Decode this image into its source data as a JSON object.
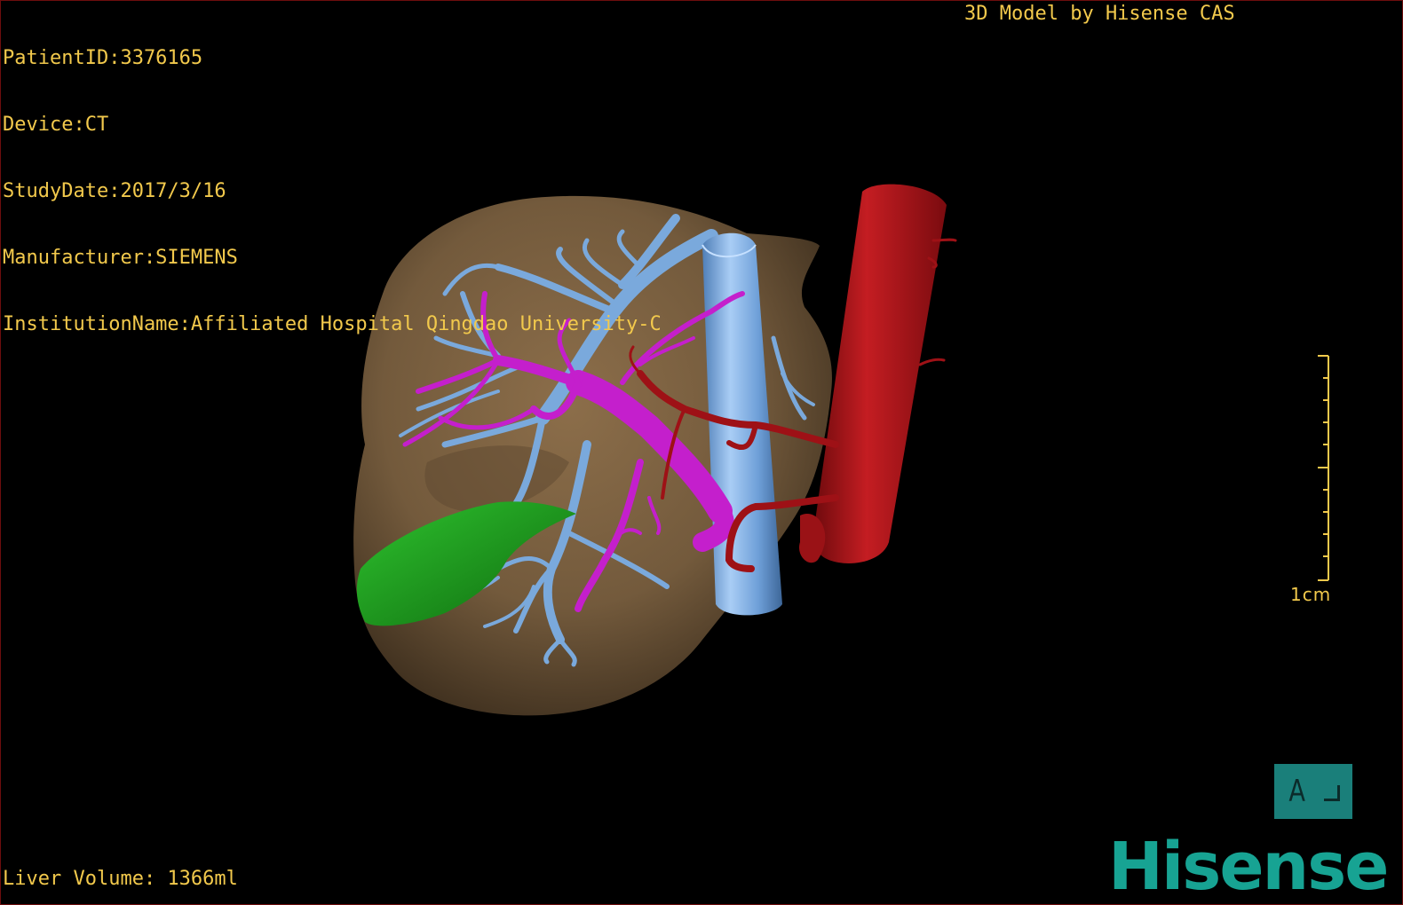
{
  "patient_info": {
    "patient_id": "PatientID:3376165",
    "device": "Device:CT",
    "study_date": "StudyDate:2017/3/16",
    "manufacturer": "Manufacturer:SIEMENS",
    "institution": "InstitutionName:Affiliated Hospital Qingdao University-C"
  },
  "model_credit": "3D Model by Hisense CAS",
  "liver_volume": "Liver Volume: 1366ml",
  "scale": {
    "label": "1cm"
  },
  "orientation": {
    "letter": "A"
  },
  "brand": "Hisense",
  "colors": {
    "overlay_text": "#f2c94c",
    "liver": "#7a6040",
    "hepatic_vein": "#6fa0d8",
    "portal_vein": "#c41fcc",
    "artery_ivc": "#b0151a",
    "gallbladder": "#1f9a1f",
    "brand": "#17a393",
    "orientation_box": "#1a7f7a"
  }
}
